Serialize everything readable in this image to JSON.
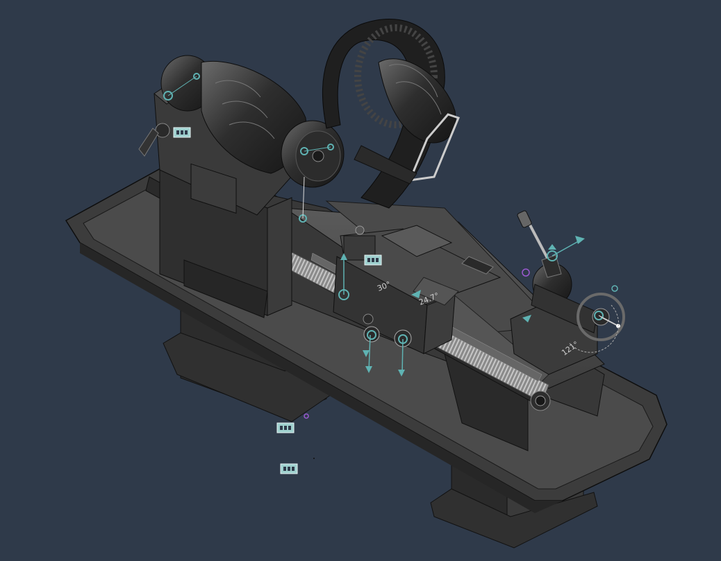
{
  "viewport": {
    "background": "#2f3a4a",
    "model": "lathe",
    "accent": "#5fb3b3"
  },
  "dimensions": {
    "cross_slide_angle": "30°",
    "compound_label": "24.7°",
    "tailstock_angle": "121°"
  },
  "icons": {
    "joint_glyph": "joint-icon",
    "rigid_group_glyph": "rigid-group-icon",
    "pin_glyph": "pin-icon"
  }
}
